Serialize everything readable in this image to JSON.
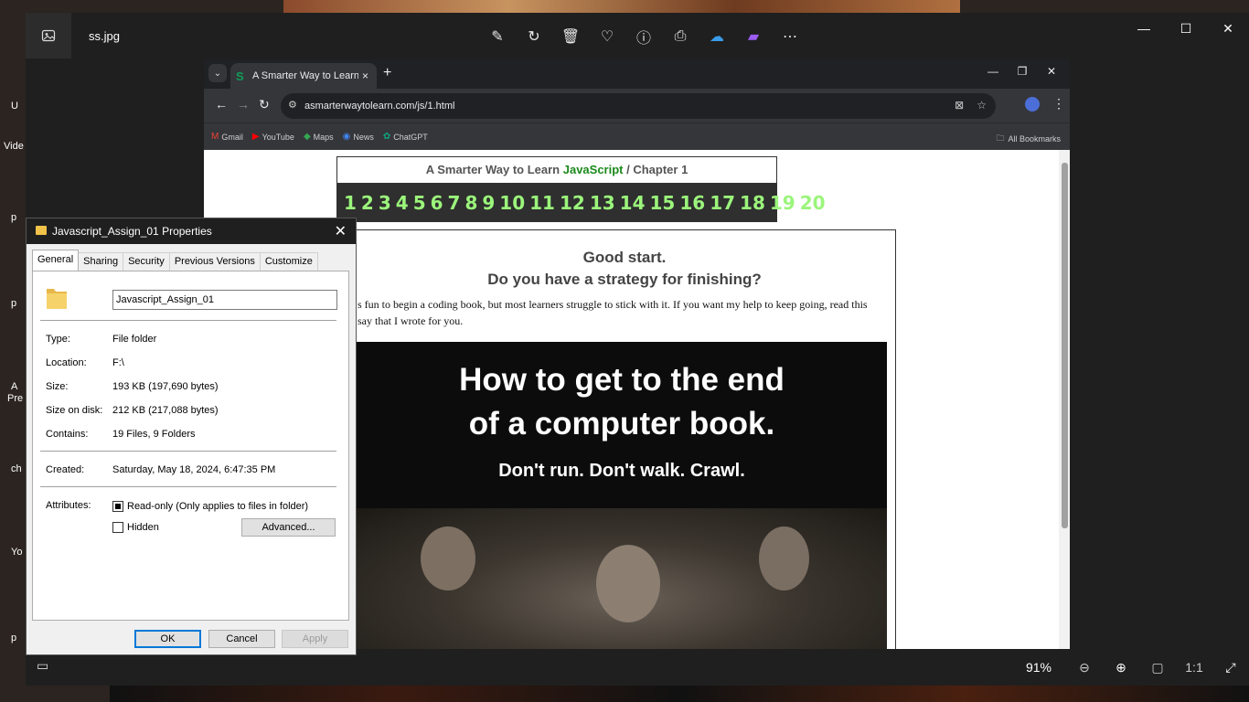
{
  "viewer": {
    "filename": "ss.jpg",
    "zoom": "91%",
    "tools": [
      "edit-icon",
      "rotate-icon",
      "delete-icon",
      "favorite-icon",
      "info-icon",
      "print-icon",
      "onedrive-icon",
      "clipchamp-icon",
      "more-icon"
    ]
  },
  "chrome": {
    "tab_title": "A Smarter Way to Learn JavaScript",
    "tab_close": "×",
    "new_tab": "+",
    "url": "asmarterwaytolearn.com/js/1.html",
    "bookmarks": [
      "Gmail",
      "YouTube",
      "Maps",
      "News",
      "ChatGPT"
    ],
    "all_bookmarks": "All Bookmarks"
  },
  "site": {
    "header_prefix": "A Smarter Way to Learn ",
    "header_js": "JavaScript",
    "header_suffix": " / Chapter 1",
    "chapters": [
      "1",
      "2",
      "3",
      "4",
      "5",
      "6",
      "7",
      "8",
      "9",
      "10",
      "11",
      "12",
      "13",
      "14",
      "15",
      "16",
      "17",
      "18",
      "19",
      "20"
    ],
    "headline1": "Good start.",
    "headline2": "Do you have a strategy for finishing?",
    "intro_line1": "s fun to begin a coding book, but most learners struggle to stick with it. If you want my help to keep going, read this",
    "intro_line2": "say that I wrote for you.",
    "banner_line1": "How to get to the end",
    "banner_line2": "of a computer book.",
    "banner_line3": "Don't run. Don't walk. Crawl."
  },
  "dialog": {
    "title": "Javascript_Assign_01 Properties",
    "tabs": [
      "General",
      "Sharing",
      "Security",
      "Previous Versions",
      "Customize"
    ],
    "name_value": "Javascript_Assign_01",
    "props": {
      "type_label": "Type:",
      "type_value": "File folder",
      "location_label": "Location:",
      "location_value": "F:\\",
      "size_label": "Size:",
      "size_value": "193 KB (197,690 bytes)",
      "size_disk_label": "Size on disk:",
      "size_disk_value": "212 KB (217,088 bytes)",
      "contains_label": "Contains:",
      "contains_value": "19 Files, 9 Folders",
      "created_label": "Created:",
      "created_value": "Saturday, May 18, 2024, 6:47:35 PM",
      "attributes_label": "Attributes:",
      "readonly_label": "Read-only (Only applies to files in folder)",
      "hidden_label": "Hidden",
      "advanced_label": "Advanced..."
    },
    "ok": "OK",
    "cancel": "Cancel",
    "apply": "Apply"
  },
  "desktop": {
    "labels": [
      "U",
      "Vide",
      "p",
      "p",
      "A",
      "Pre",
      "ch",
      "Yo",
      "p"
    ]
  }
}
